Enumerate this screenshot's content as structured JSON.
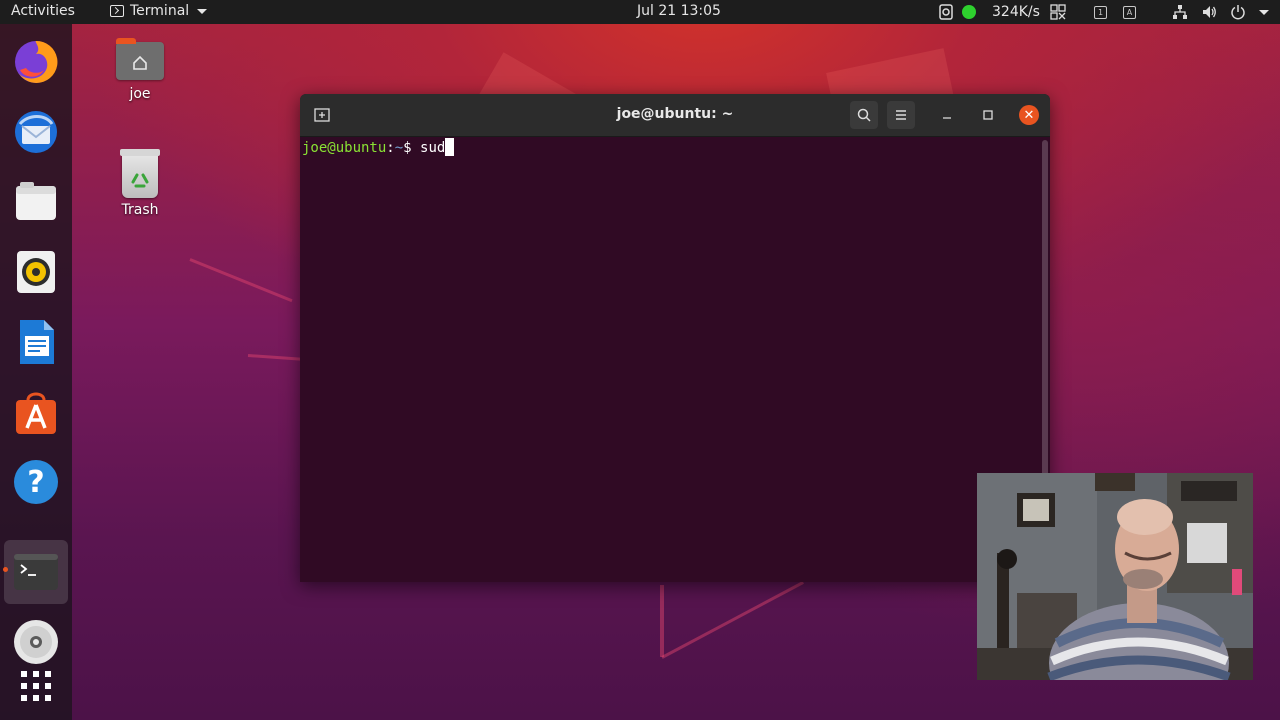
{
  "topbar": {
    "activities": "Activities",
    "app_name": "Terminal",
    "clock": "Jul 21  13:05",
    "net_speed": "324K/s",
    "ws_label": "1",
    "input_label": "A"
  },
  "desktop": {
    "icons": [
      {
        "label": "joe"
      },
      {
        "label": "Trash"
      }
    ]
  },
  "dock": {
    "items": [
      "firefox-icon",
      "thunderbird-icon",
      "files-icon",
      "rhythmbox-icon",
      "libreoffice-writer-icon",
      "software-center-icon",
      "help-icon",
      "terminal-icon",
      "dvd-icon",
      "show-apps-icon"
    ]
  },
  "terminal": {
    "title": "joe@ubuntu: ~",
    "prompt_user": "joe@ubuntu",
    "prompt_sep": ":",
    "prompt_path": "~",
    "prompt_symbol": "$ ",
    "typed": "sud"
  },
  "colors": {
    "accent": "#e95420",
    "terminal_bg": "#300a24",
    "prompt_user": "#8ae234",
    "prompt_path": "#729fcf"
  }
}
